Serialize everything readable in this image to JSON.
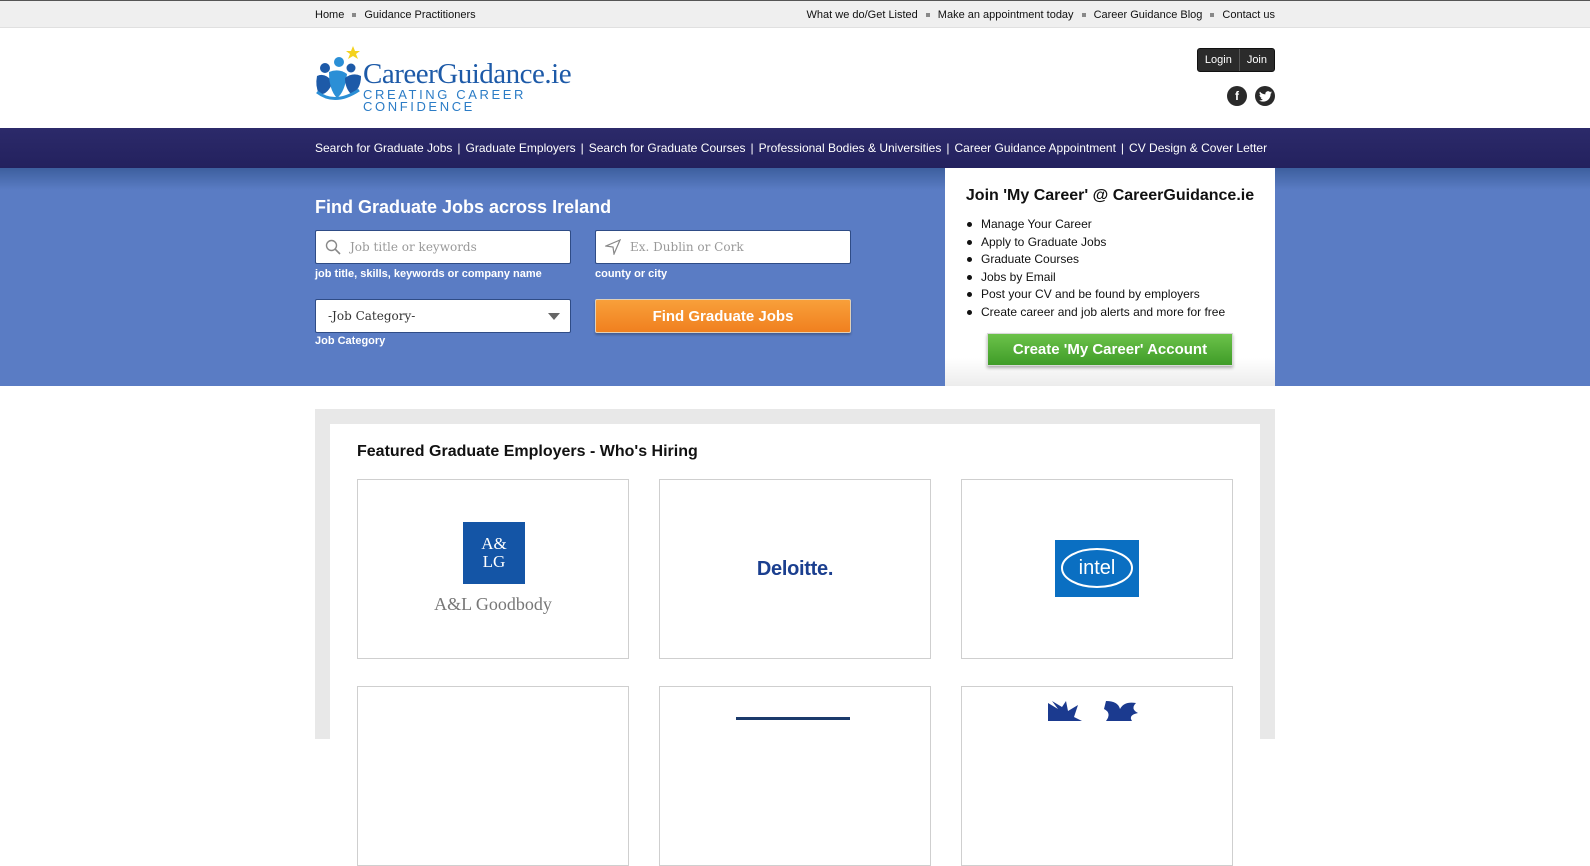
{
  "topbar": {
    "left": [
      "Home",
      "Guidance Practitioners"
    ],
    "right": [
      "What we do/Get Listed",
      "Make an appointment today",
      "Career Guidance Blog",
      "Contact us"
    ]
  },
  "header": {
    "logo_main": "CareerGuidance.ie",
    "logo_tagline": "CREATING CAREER CONFIDENCE",
    "login": "Login",
    "join": "Join",
    "social": [
      "facebook-icon",
      "twitter-icon"
    ]
  },
  "mainnav": [
    "Search for Graduate Jobs",
    "Graduate Employers",
    "Search for Graduate Courses",
    "Professional Bodies & Universities",
    "Career Guidance Appointment",
    "CV Design & Cover Letter"
  ],
  "search": {
    "title": "Find Graduate Jobs across Ireland",
    "keywords_placeholder": "Job title or keywords",
    "keywords_hint": "job title, skills, keywords or company name",
    "location_placeholder": "Ex. Dublin or Cork",
    "location_hint": "county or city",
    "category_value": "-Job Category-",
    "category_hint": "Job Category",
    "submit": "Find Graduate Jobs"
  },
  "join": {
    "title": "Join 'My Career' @ CareerGuidance.ie",
    "benefits": [
      "Manage Your Career",
      "Apply to Graduate Jobs",
      "Graduate Courses",
      "Jobs by Email",
      "Post your CV and be found by employers",
      "Create career and job alerts and more for free"
    ],
    "cta": "Create 'My Career' Account"
  },
  "featured": {
    "title": "Featured Graduate Employers - Who's Hiring",
    "employers": [
      {
        "logo_mark": "A&\nLG",
        "name": "A&L Goodbody"
      },
      {
        "name": "Deloitte."
      },
      {
        "name": "intel"
      }
    ]
  },
  "colors": {
    "nav_bg": "#26245f",
    "hero_bg": "#5a7cc4",
    "find_button": "#f39030",
    "create_button": "#52ae36",
    "brand_blue": "#1d5aa8"
  }
}
